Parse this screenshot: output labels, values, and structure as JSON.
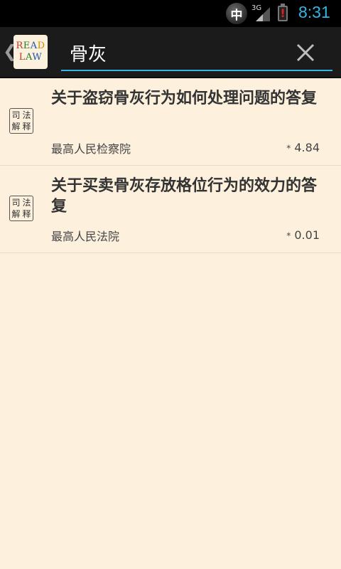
{
  "status_bar": {
    "ime_label": "中",
    "network_label": "3G",
    "time": "8:31",
    "battery_alert": "!"
  },
  "action_bar": {
    "back_glyph": "❮",
    "logo_line1": "READ",
    "logo_line2": "LAW",
    "logo_colors": [
      "#c0392b",
      "#2a7a2a",
      "#2255aa",
      "#d48a00"
    ],
    "search": {
      "value": "骨灰",
      "placeholder": ""
    }
  },
  "results": [
    {
      "type_label_chars": [
        "司",
        "法",
        "解",
        "释"
      ],
      "title": "关于盗窃骨灰行为如何处理问题的答复",
      "source": "最高人民检察院",
      "score_prefix": "*",
      "score": "4.84"
    },
    {
      "type_label_chars": [
        "司",
        "法",
        "解",
        "释"
      ],
      "title": "关于买卖骨灰存放格位行为的效力的答复",
      "source": "最高人民法院",
      "score_prefix": "*",
      "score": "0.01"
    }
  ],
  "colors": {
    "background": "#fdf1de",
    "accent": "#33b5e5",
    "action_bar": "#1b1b1b"
  }
}
